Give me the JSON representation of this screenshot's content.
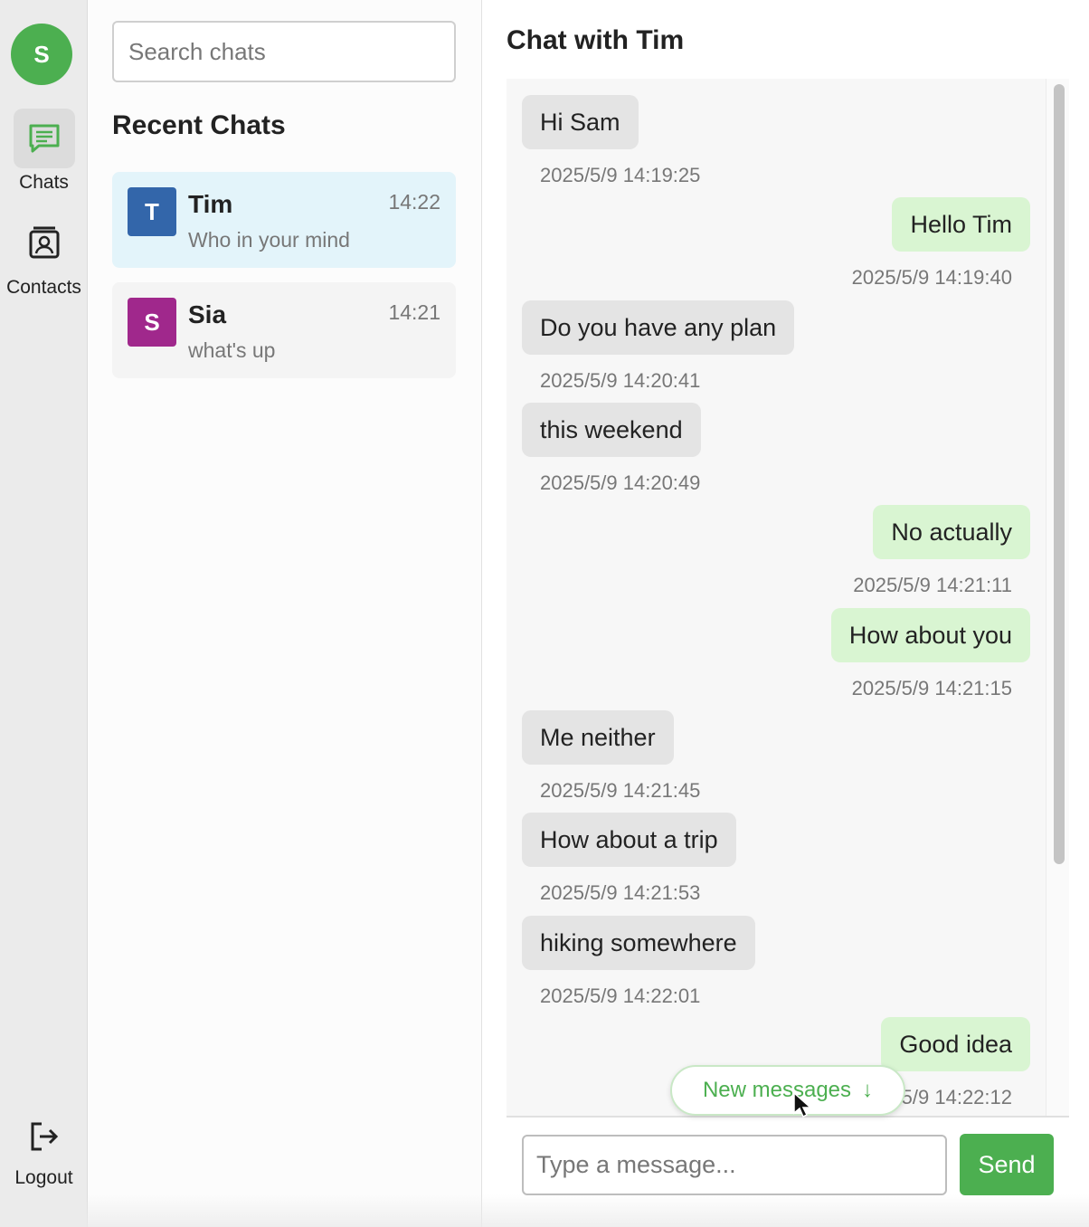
{
  "user": {
    "initial": "S",
    "color": "#4caf50"
  },
  "nav": {
    "chats_label": "Chats",
    "contacts_label": "Contacts",
    "logout_label": "Logout",
    "active": "chats"
  },
  "sidebar": {
    "search_placeholder": "Search chats",
    "title": "Recent Chats",
    "chats": [
      {
        "initial": "T",
        "name": "Tim",
        "time": "14:22",
        "preview": "Who in your mind",
        "avatar_color": "#3366aa",
        "active": true
      },
      {
        "initial": "S",
        "name": "Sia",
        "time": "14:21",
        "preview": "what's up",
        "avatar_color": "#a0288c",
        "active": false
      }
    ]
  },
  "conversation": {
    "title": "Chat with Tim",
    "messages": [
      {
        "direction": "in",
        "text": "Hi Sam",
        "time": "2025/5/9 14:19:25"
      },
      {
        "direction": "out",
        "text": "Hello Tim",
        "time": "2025/5/9 14:19:40"
      },
      {
        "direction": "in",
        "text": "Do you have any plan",
        "time": "2025/5/9 14:20:41"
      },
      {
        "direction": "in",
        "text": "this weekend",
        "time": "2025/5/9 14:20:49"
      },
      {
        "direction": "out",
        "text": "No actually",
        "time": "2025/5/9 14:21:11"
      },
      {
        "direction": "out",
        "text": "How about you",
        "time": "2025/5/9 14:21:15"
      },
      {
        "direction": "in",
        "text": "Me neither",
        "time": "2025/5/9 14:21:45"
      },
      {
        "direction": "in",
        "text": "How about a trip",
        "time": "2025/5/9 14:21:53"
      },
      {
        "direction": "in",
        "text": "hiking somewhere",
        "time": "2025/5/9 14:22:01"
      },
      {
        "direction": "out",
        "text": "Good idea",
        "time": "2025/5/9 14:22:12"
      }
    ],
    "new_messages_label": "New messages",
    "new_messages_arrow": "↓"
  },
  "composer": {
    "placeholder": "Type a message...",
    "send_label": "Send"
  },
  "colors": {
    "accent": "#4caf50",
    "incoming_bubble": "#e4e4e4",
    "outgoing_bubble": "#d9f5d2",
    "active_chat_bg": "#e3f4fa"
  }
}
